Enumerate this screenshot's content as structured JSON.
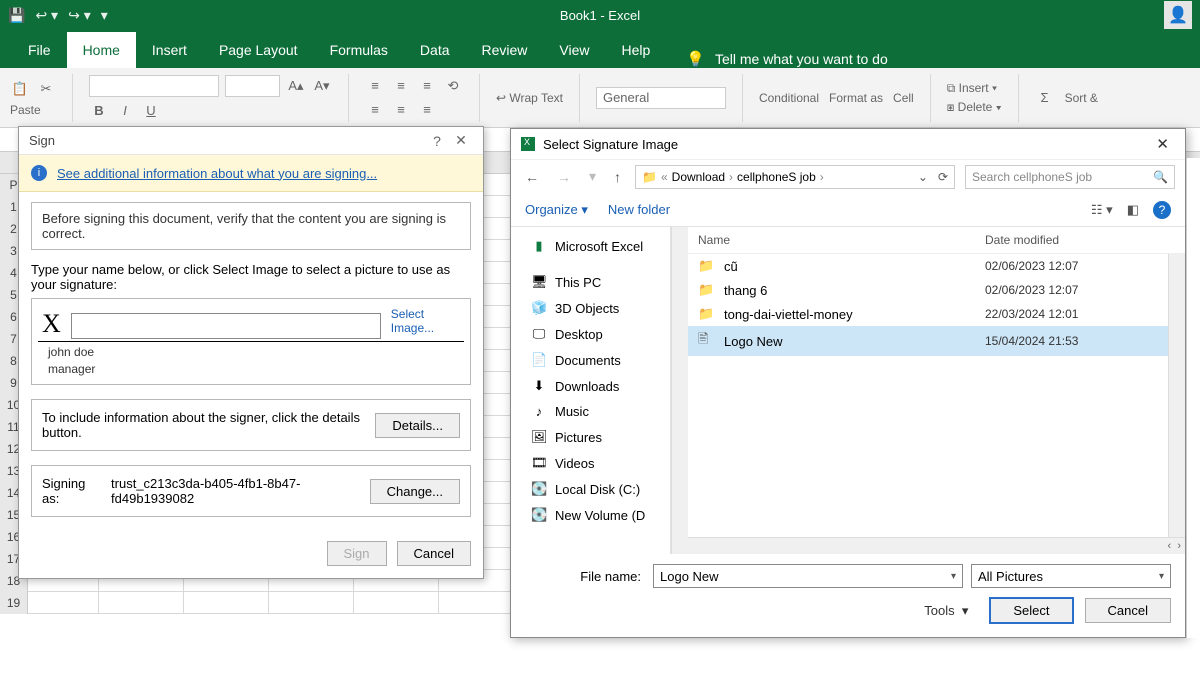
{
  "titlebar": {
    "title": "Book1  -  Excel"
  },
  "tabs": {
    "file": "File",
    "home": "Home",
    "insert": "Insert",
    "layout": "Page Layout",
    "formulas": "Formulas",
    "data": "Data",
    "review": "Review",
    "view": "View",
    "help": "Help",
    "tell": "Tell me what you want to do"
  },
  "ribbon": {
    "paste": "Paste",
    "wrap": "Wrap Text",
    "numfmt": "General",
    "cond": "Conditional",
    "fmtas": "Format as",
    "cell": "Cell",
    "insert": "Insert",
    "delete": "Delete",
    "sort": "Sort &"
  },
  "sign": {
    "title": "Sign",
    "info_link": "See additional information about what you are signing...",
    "verify": "Before signing this document, verify that the content you are signing is correct.",
    "type_instr": "Type your name below, or click Select Image to select a picture to use as your signature:",
    "x": "X",
    "select_image": "Select Image...",
    "name": "john doe",
    "role": "manager",
    "include_info": "To include information about the signer, click the details button.",
    "details": "Details...",
    "signing_as_label": "Signing as:",
    "signing_as_value": "trust_c213c3da-b405-4fb1-8b47-fd49b1939082",
    "change": "Change...",
    "sign_btn": "Sign",
    "cancel_btn": "Cancel"
  },
  "picker": {
    "title": "Select Signature Image",
    "path": {
      "prefix": "«",
      "p1": "Download",
      "p2": "cellphoneS job"
    },
    "search_placeholder": "Search cellphoneS job",
    "organize": "Organize",
    "new_folder": "New folder",
    "tree": {
      "excel": "Microsoft Excel",
      "pc": "This PC",
      "threed": "3D Objects",
      "desktop": "Desktop",
      "documents": "Documents",
      "downloads": "Downloads",
      "music": "Music",
      "pictures": "Pictures",
      "videos": "Videos",
      "cdrive": "Local Disk (C:)",
      "ddrive": "New Volume (D"
    },
    "cols": {
      "name": "Name",
      "date": "Date modified"
    },
    "files": [
      {
        "name": "cũ",
        "date": "02/06/2023 12:07",
        "type": "folder"
      },
      {
        "name": "thang 6",
        "date": "02/06/2023 12:07",
        "type": "folder"
      },
      {
        "name": "tong-dai-viettel-money",
        "date": "22/03/2024 12:01",
        "type": "folder"
      },
      {
        "name": "Logo New",
        "date": "15/04/2024 21:53",
        "type": "file"
      }
    ],
    "filename_label": "File name:",
    "filename_value": "Logo New",
    "filter": "All Pictures",
    "tools": "Tools",
    "select": "Select",
    "cancel": "Cancel"
  }
}
